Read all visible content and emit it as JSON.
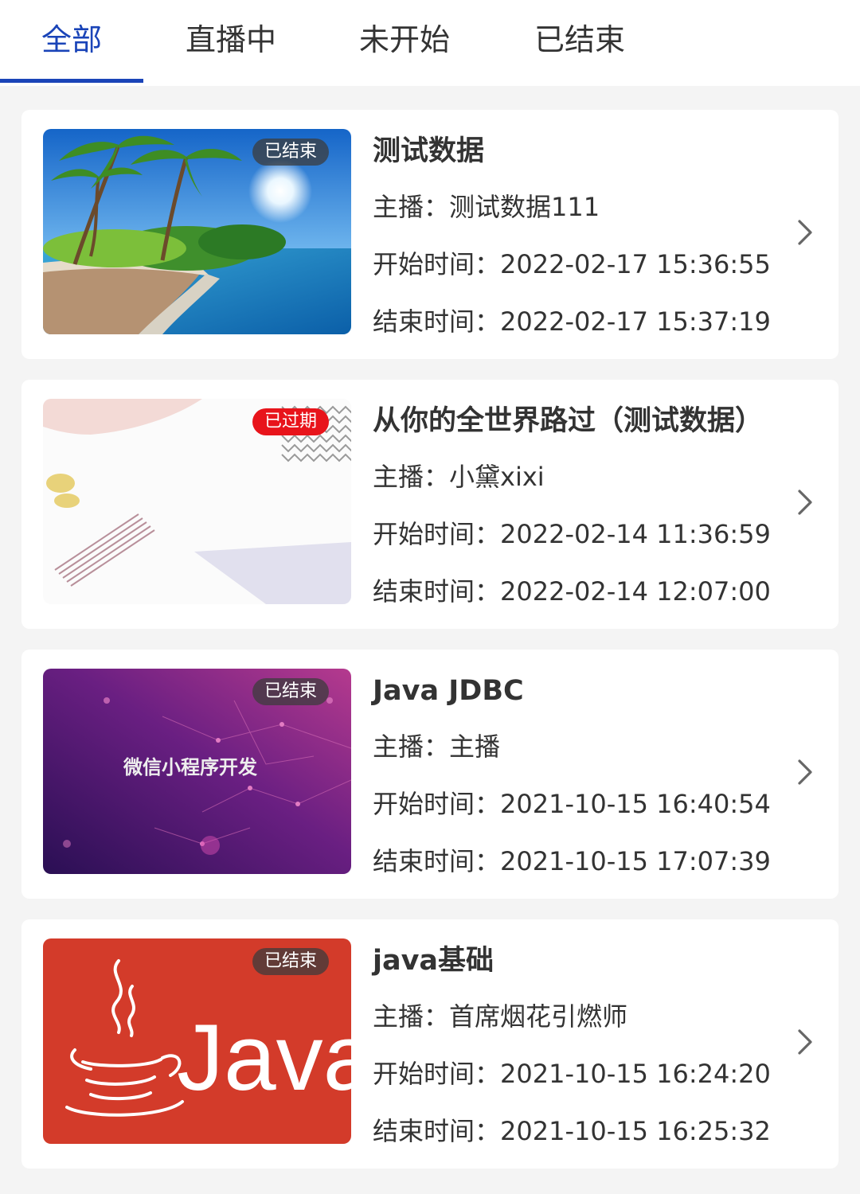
{
  "tabs": [
    {
      "label": "全部",
      "active": true
    },
    {
      "label": "直播中",
      "active": false
    },
    {
      "label": "未开始",
      "active": false
    },
    {
      "label": "已结束",
      "active": false
    }
  ],
  "labels": {
    "host": "主播：",
    "start": "开始时间：",
    "end": "结束时间："
  },
  "items": [
    {
      "title": "测试数据",
      "badge": "已结束",
      "badge_color": "#4a4a4a",
      "host": "测试数据111",
      "start_time": "2022-02-17 15:36:55",
      "end_time": "2022-02-17 15:37:19",
      "thumb": "beach-palm-trees"
    },
    {
      "title": "从你的全世界路过（测试数据）",
      "badge": "已过期",
      "badge_color": "#e8141b",
      "host": "小黛xixi",
      "start_time": "2022-02-14 11:36:59",
      "end_time": "2022-02-14 12:07:00",
      "thumb": "abstract-pastel"
    },
    {
      "title": "Java JDBC",
      "badge": "已结束",
      "badge_color": "#4a4a4a",
      "host": "主播",
      "start_time": "2021-10-15 16:40:54",
      "end_time": "2021-10-15 17:07:39",
      "thumb": "purple-wechat-miniprogram",
      "thumb_text": "微信小程序开发"
    },
    {
      "title": "java基础",
      "badge": "已结束",
      "badge_color": "#4a4a4a",
      "host": "首席烟花引燃师",
      "start_time": "2021-10-15 16:24:20",
      "end_time": "2021-10-15 16:25:32",
      "thumb": "java-logo",
      "thumb_text": "Java"
    }
  ],
  "colors": {
    "accent": "#1a44b8",
    "background": "#f4f4f4",
    "card": "#ffffff",
    "expired": "#e8141b"
  }
}
